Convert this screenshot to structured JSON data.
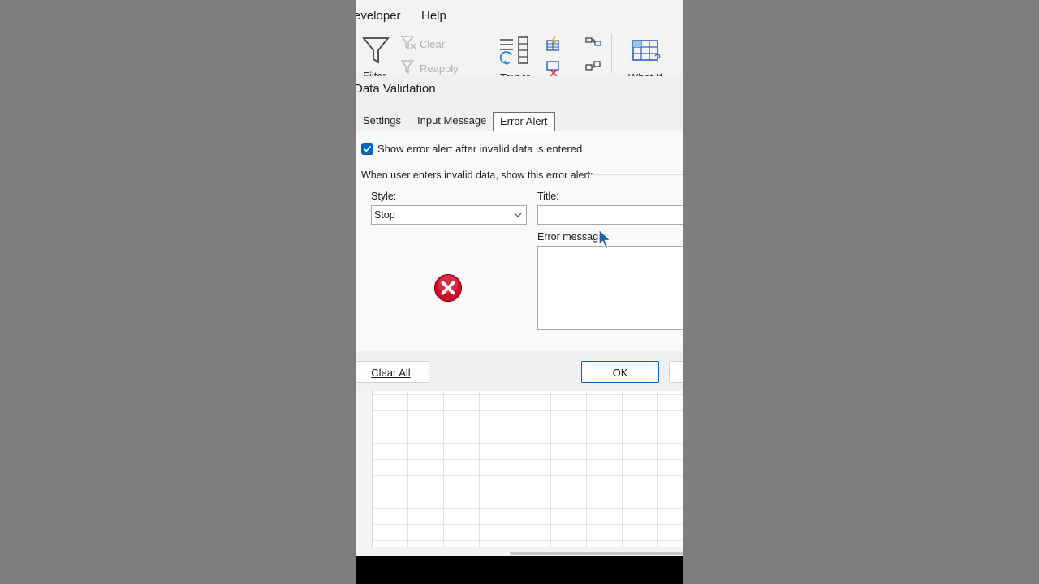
{
  "ribbon": {
    "tabs": [
      "eveloper",
      "Help"
    ],
    "filter_label": "Filter",
    "clear_label": "Clear",
    "reapply_label": "Reapply",
    "text_to_label": "Text to",
    "what_if_label": "What-If"
  },
  "dialog": {
    "title": "Data Validation",
    "tabs": [
      {
        "label": "Settings",
        "active": false
      },
      {
        "label": "Input Message",
        "active": false
      },
      {
        "label": "Error Alert",
        "active": true
      }
    ],
    "show_alert_checkbox": {
      "label": "Show error alert after invalid data is entered",
      "checked": true
    },
    "group_label": "When user enters invalid data, show this error alert:",
    "style": {
      "label": "Style:",
      "value": "Stop"
    },
    "title_field": {
      "label": "Title:",
      "value": ""
    },
    "message_field": {
      "label": "Error message:",
      "value": ""
    },
    "buttons": {
      "clear_all": "Clear All",
      "ok": "OK",
      "cancel": ""
    }
  },
  "colors": {
    "accent": "#0067c0",
    "stop_red": "#c8102e",
    "dialog_bg": "#f0f0f0",
    "side_bg": "#7e7e7e"
  }
}
